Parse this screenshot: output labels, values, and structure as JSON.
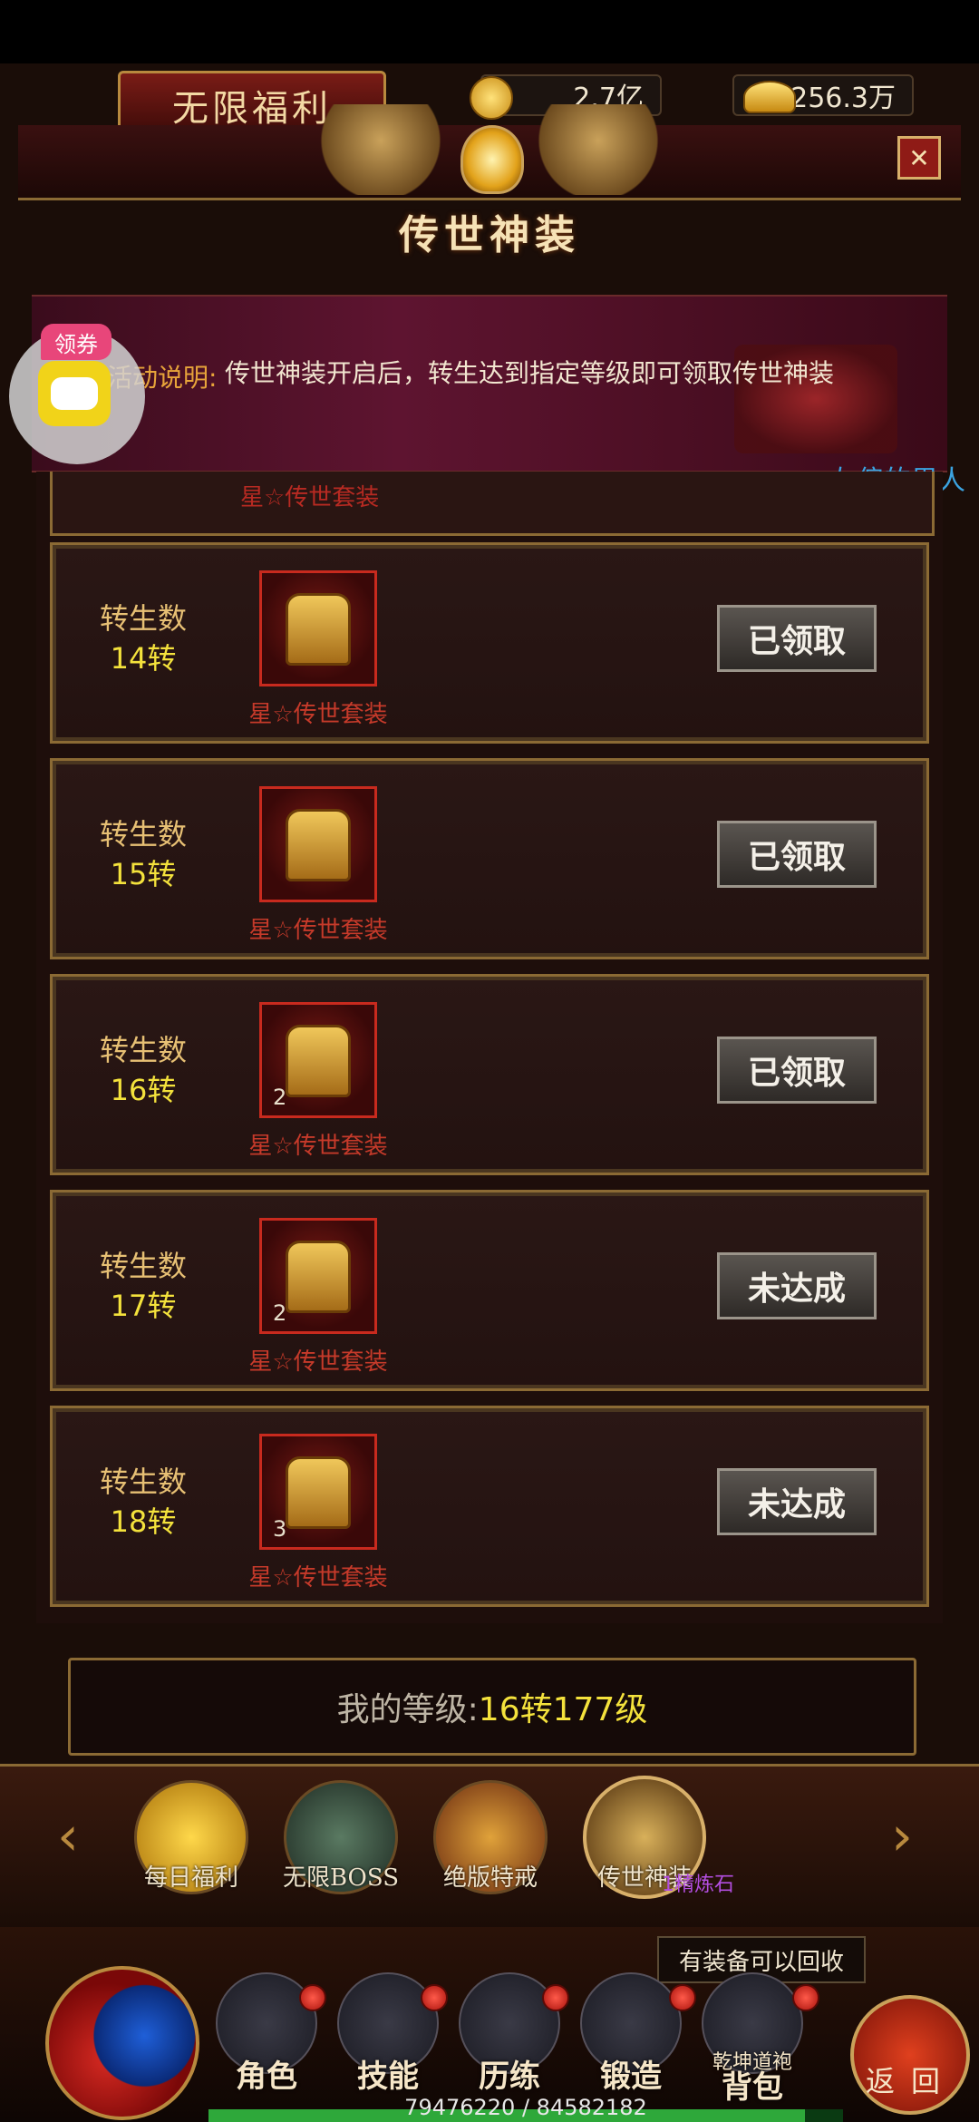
{
  "header": {
    "title": "无限福利",
    "currency_coin": "2.7亿",
    "currency_ingot": "256.3万",
    "panel_title": "传世神装",
    "close_label": "✕"
  },
  "description": {
    "label": "活动说明:",
    "text": "传世神装开启后，转生达到指定等级即可领取传世神装"
  },
  "overlay": {
    "coupon_badge": "领券",
    "side_label": "左偏的男人"
  },
  "partial_row_text": "星☆传世套装",
  "rewards": [
    {
      "label": "转生数",
      "value": "14转",
      "item_name": "星☆传世套装",
      "qty": "",
      "button": "已领取"
    },
    {
      "label": "转生数",
      "value": "15转",
      "item_name": "星☆传世套装",
      "qty": "",
      "button": "已领取"
    },
    {
      "label": "转生数",
      "value": "16转",
      "item_name": "星☆传世套装",
      "qty": "2",
      "button": "已领取"
    },
    {
      "label": "转生数",
      "value": "17转",
      "item_name": "星☆传世套装",
      "qty": "2",
      "button": "未达成"
    },
    {
      "label": "转生数",
      "value": "18转",
      "item_name": "星☆传世套装",
      "qty": "3",
      "button": "未达成"
    }
  ],
  "my_level": {
    "label": "我的等级:",
    "value": "16转177级"
  },
  "tabs": [
    {
      "label": "每日福利"
    },
    {
      "label": "无限BOSS"
    },
    {
      "label": "绝版特戒"
    },
    {
      "label": "传世神装"
    }
  ],
  "tab_arrows": {
    "left": "‹",
    "right": "›"
  },
  "floating": {
    "refine_stone": "1精炼石",
    "recycle_tip": "有装备可以回收"
  },
  "bottom_nav": [
    {
      "label": "角色"
    },
    {
      "label": "技能"
    },
    {
      "label": "历练"
    },
    {
      "label": "锻造"
    },
    {
      "label": "背包",
      "sub": "乾坤道袍"
    }
  ],
  "return_label": "返回",
  "xp": {
    "text": "79476220 / 84582182",
    "fraction": 0.9396
  },
  "colors": {
    "accent_gold": "#f4e23c",
    "label_gold": "#e7c074",
    "item_red": "#c63a2a",
    "frame": "#8b6a34"
  }
}
